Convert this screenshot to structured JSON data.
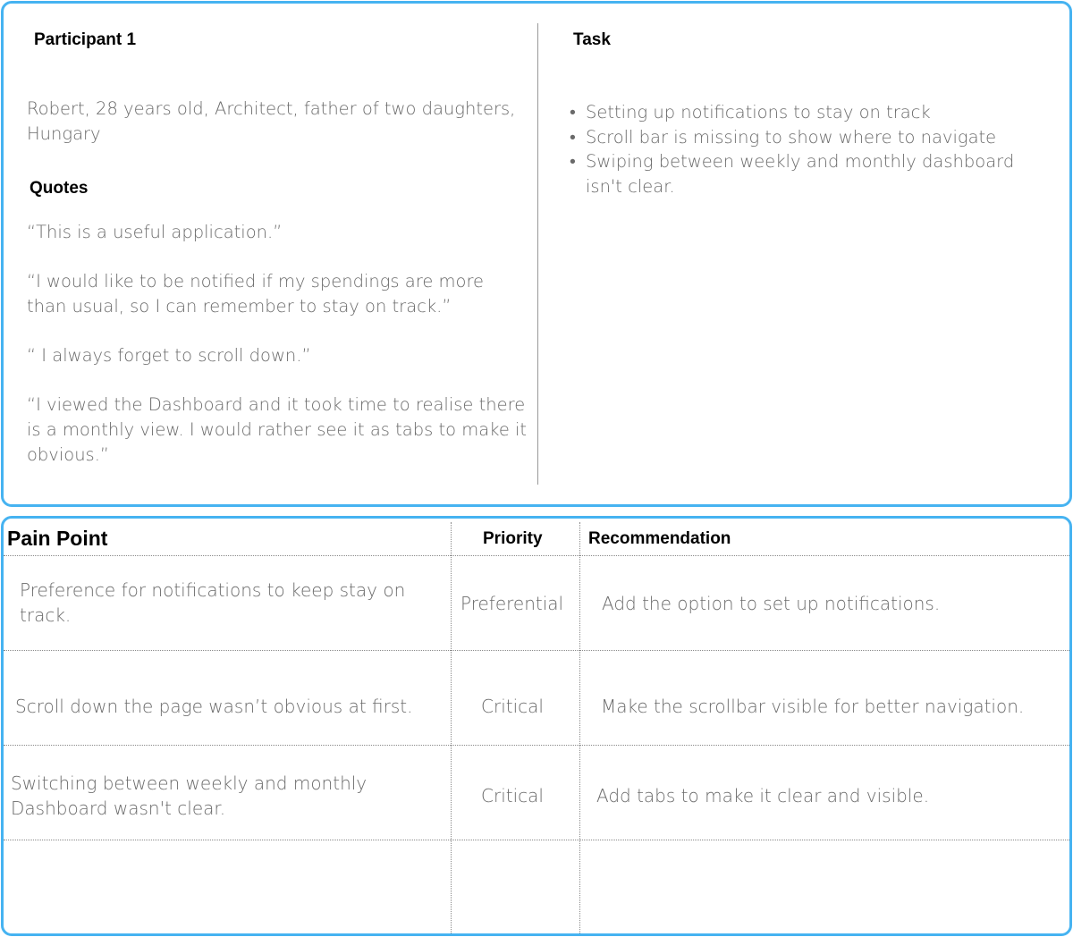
{
  "participant": {
    "heading": "Participant 1",
    "description": "Robert, 28 years old, Architect, father of two daughters, Hungary"
  },
  "quotes": {
    "heading": "Quotes",
    "items": [
      "“This is a useful application.”",
      "“I would like to be notified if my spendings are more than usual, so I can remember to stay on track.”",
      "“ I always forget to scroll down.”",
      "“I viewed the Dashboard and it took time to realise there is a monthly view. I would rather see it as tabs to make it obvious.”"
    ]
  },
  "task": {
    "heading": "Task",
    "items": [
      "Setting up notifications to stay on track",
      "Scroll bar is missing to show where to navigate",
      "Swiping between weekly and monthly dashboard isn't clear."
    ]
  },
  "table": {
    "headers": {
      "pain_point": "Pain Point",
      "priority": "Priority",
      "recommendation": "Recommendation"
    },
    "rows": [
      {
        "pain_point": "Preference for notifications to keep stay on track.",
        "priority": "Preferential",
        "recommendation": "Add the option to set up notifications."
      },
      {
        "pain_point": "Scroll down the page wasn’t obvious at first.",
        "priority": "Critical",
        "recommendation": "Make the scrollbar visible for better navigation."
      },
      {
        "pain_point": "Switching between weekly and monthly Dashboard wasn't clear.",
        "priority": "Critical",
        "recommendation": "Add tabs to make it clear and visible."
      },
      {
        "pain_point": "",
        "priority": "",
        "recommendation": ""
      }
    ]
  },
  "colors": {
    "card_border": "#46b3f1",
    "body_text": "#6a6a6a",
    "heading_text": "#000000"
  }
}
